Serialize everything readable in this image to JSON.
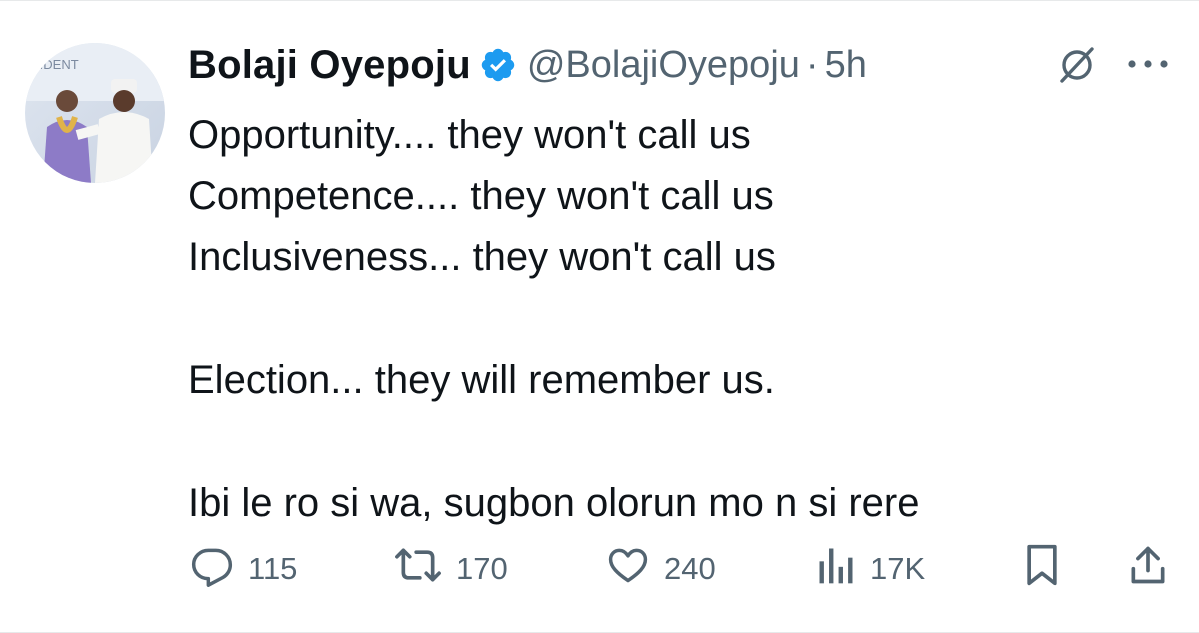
{
  "tweet": {
    "author": {
      "name": "Bolaji Oyepoju",
      "handle": "@BolajiOyepoju",
      "separator": "·",
      "time": "5h",
      "verified": true,
      "avatar_banner_text": "SIDENT"
    },
    "body_lines": [
      "Opportunity.... they won't call us",
      "Competence.... they won't call us",
      "Inclusiveness... they won't call us",
      "",
      "Election... they will remember us.",
      "",
      "Ibi le ro si wa, sugbon olorun mo n si rere"
    ],
    "actions": {
      "replies": "115",
      "reposts": "170",
      "likes": "240",
      "views": "17K"
    }
  },
  "icons": {
    "verified": "verified-badge-icon",
    "grok": "grok-icon",
    "more": "more-icon",
    "reply": "reply-icon",
    "repost": "repost-icon",
    "like": "heart-icon",
    "views": "views-chart-icon",
    "bookmark": "bookmark-icon",
    "share": "share-icon"
  },
  "colors": {
    "text": "#0f1419",
    "secondary": "#536471",
    "verified_blue": "#1d9bf0",
    "divider": "#e7e9ea"
  }
}
